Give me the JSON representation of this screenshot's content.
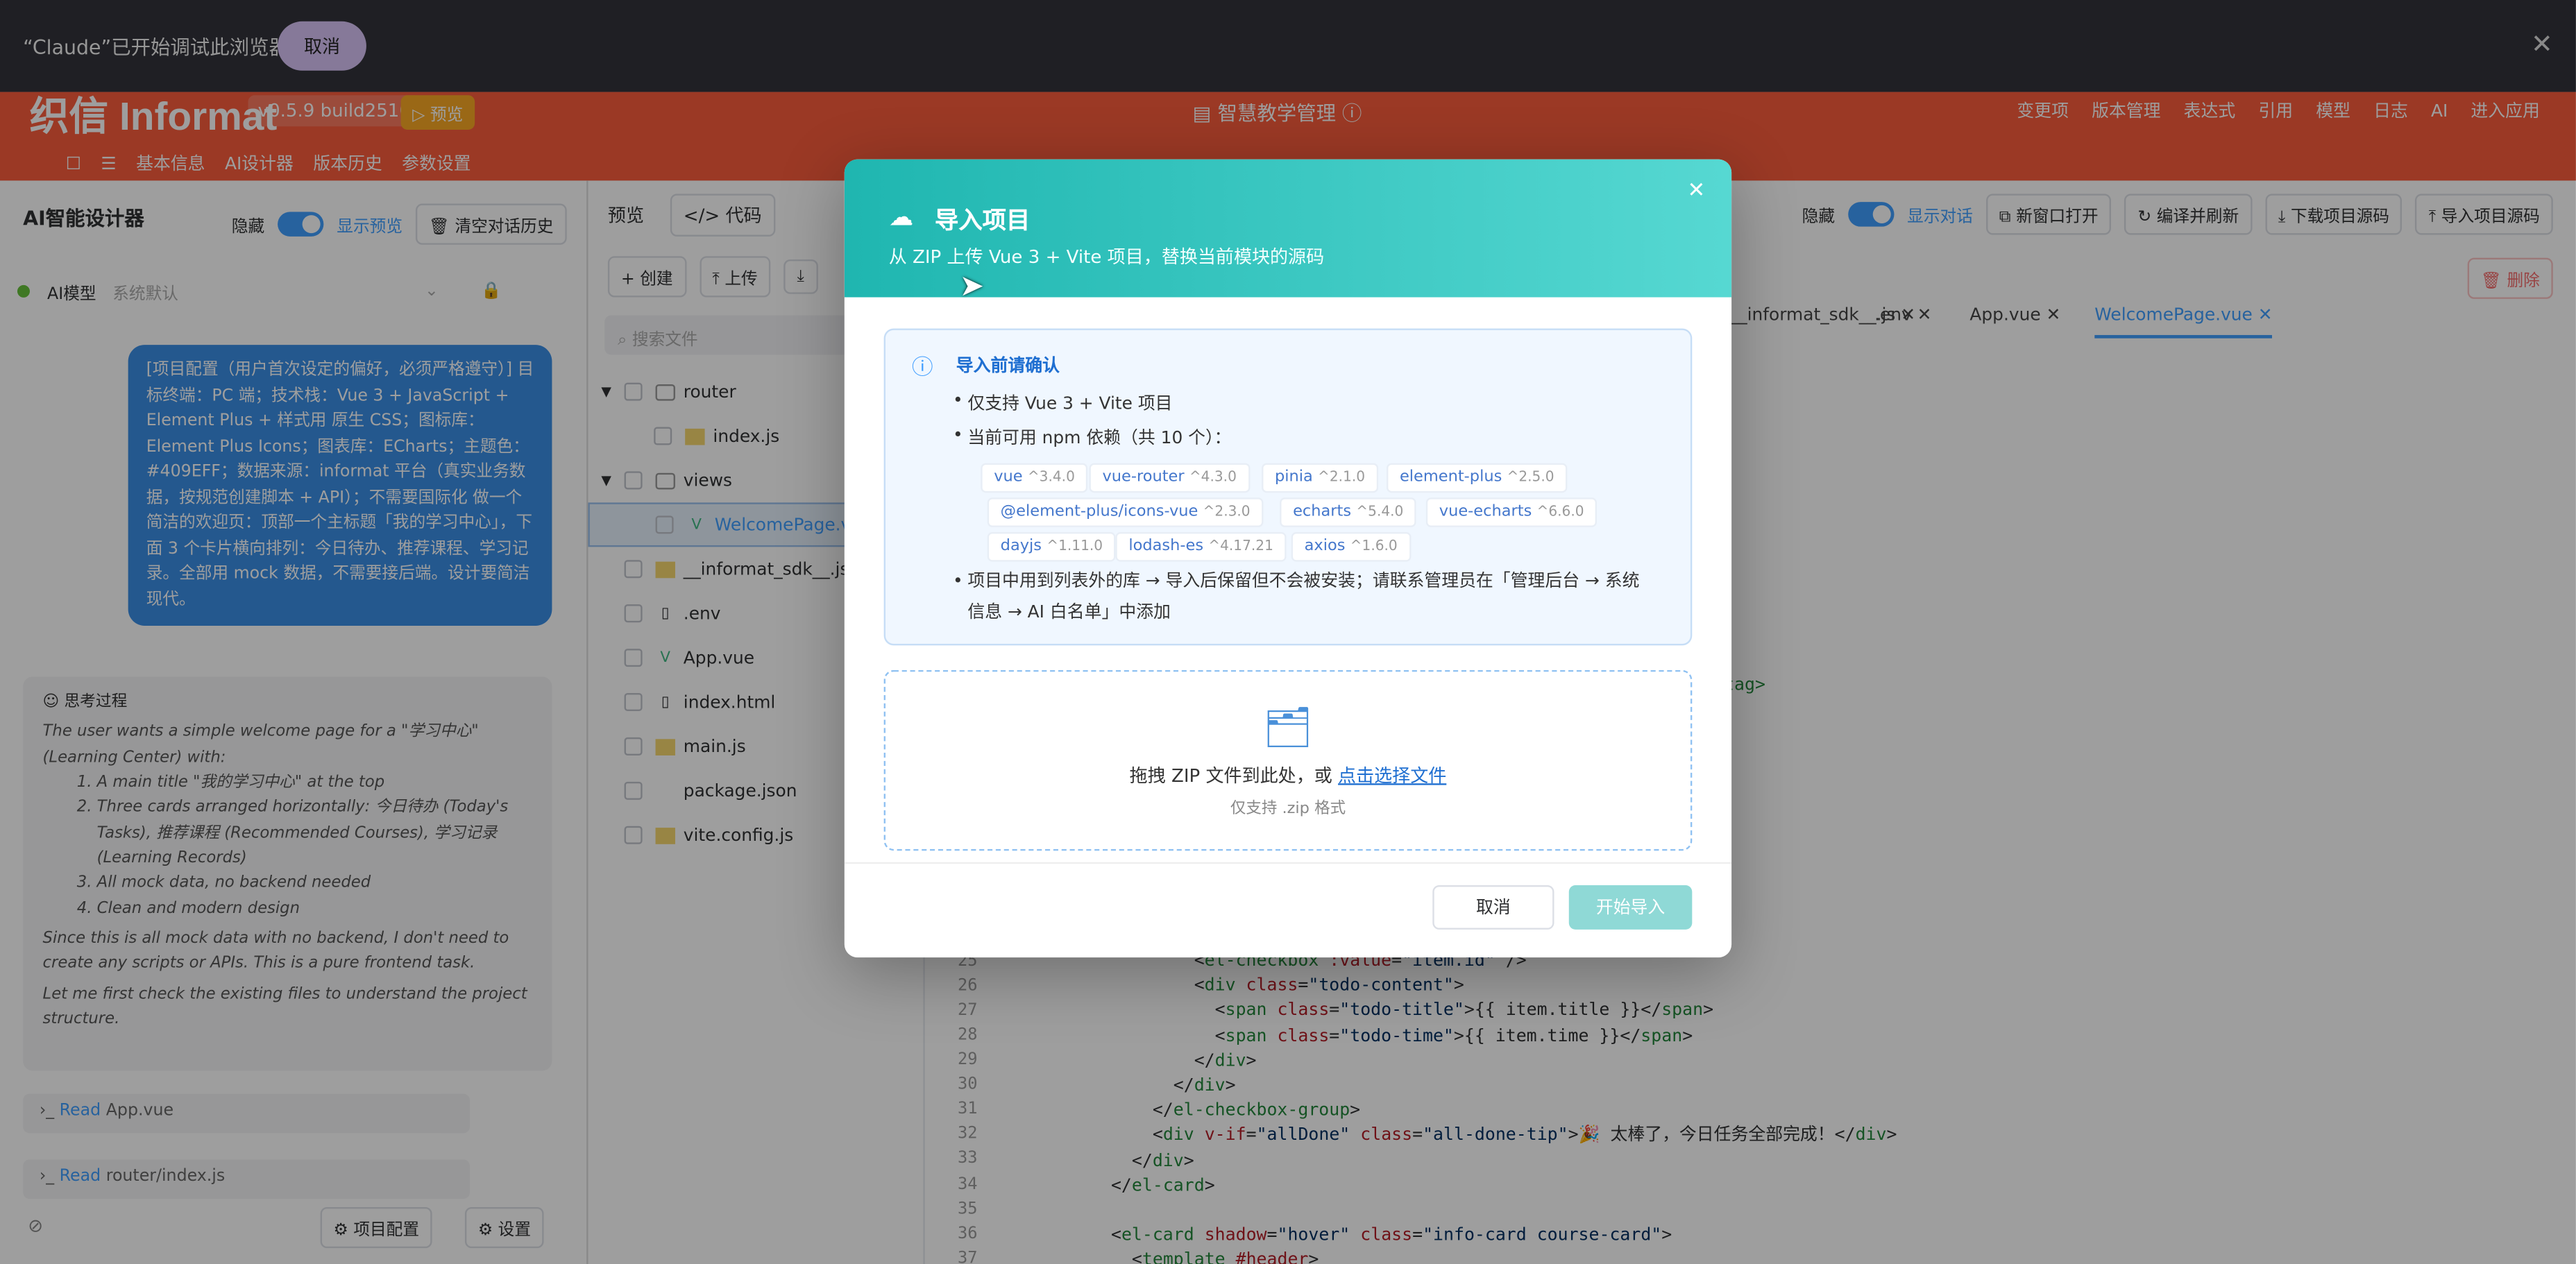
{
  "banner": {
    "text": "“Claude”已开始调试此浏览器",
    "cancel": "取消",
    "close": "✕"
  },
  "header": {
    "logo": "织信 Informat",
    "version": "v0.5.9 build2510",
    "preview_badge": "▷ 预览",
    "title": "智慧教学管理",
    "menu": [
      "变更项",
      "版本管理",
      "表达式",
      "引用",
      "模型",
      "日志",
      "AI",
      "进入应用"
    ],
    "tabs": [
      "基本信息",
      "AI设计器",
      "版本历史",
      "参数设置"
    ]
  },
  "left": {
    "title": "AI智能设计器",
    "hide": "隐藏",
    "show_preview": "显示预览",
    "clear": "清空对话历史",
    "model_label": "AI模型",
    "model_value": "系统默认",
    "user_msg": "[项目配置（用户首次设定的偏好，必须严格遵守）] 目标终端：PC 端；技术栈：Vue 3 + JavaScript + Element Plus + 样式用 原生 CSS；图标库：Element Plus Icons；图表库：ECharts；主题色：#409EFF；数据来源：informat 平台（真实业务数据，按规范创建脚本 + API）；不需要国际化 做一个简洁的欢迎页：顶部一个主标题「我的学习中心」，下面 3 个卡片横向排列：今日待办、推荐课程、学习记录。全部用 mock 数据，不需要接后端。设计要简洁现代。",
    "think_title": "思考过程",
    "think_intro": "The user wants a simple welcome page for a \"学习中心\" (Learning Center) with:",
    "think_items": [
      "A main title \"我的学习中心\" at the top",
      "Three cards arranged horizontally: 今日待办 (Today's Tasks), 推荐课程 (Recommended Courses), 学习记录 (Learning Records)",
      "All mock data, no backend needed",
      "Clean and modern design"
    ],
    "think_p1": "Since this is all mock data with no backend, I don't need to create any scripts or APIs. This is a pure frontend task.",
    "think_p2": "Let me first check the existing files to understand the project structure.",
    "tool1_verb": "Read",
    "tool1_file": "App.vue",
    "tool2_verb": "Read",
    "tool2_file": "router/index.js",
    "project_cfg": "项目配置",
    "settings": "设置"
  },
  "files": {
    "tab_preview": "预览",
    "tab_code": "代码",
    "create": "+ 创建",
    "upload": "上传",
    "search_placeholder": "搜索文件",
    "tree": [
      "router",
      "index.js",
      "views",
      "WelcomePage.vue",
      "__informat_sdk__.js",
      ".env",
      "App.vue",
      "index.html",
      "main.js",
      "package.json",
      "vite.config.js"
    ]
  },
  "editor": {
    "hide": "隐藏",
    "show_chat": "显示对话",
    "new_window": "新窗口打开",
    "compile": "编译并刷新",
    "download": "下载项目源码",
    "import": "导入项目源码",
    "delete": "删除",
    "tabs": [
      "__informat_sdk__.js",
      ".env",
      "App.vue",
      "WelcomePage.vue"
    ],
    "line_numbers": [
      "25",
      "26",
      "27",
      "28",
      "29",
      "30",
      "31",
      "32",
      "33",
      "34",
      "35",
      "36",
      "37"
    ],
    "fragment": "-tag>"
  },
  "modal": {
    "title": "导入项目",
    "subtitle": "从 ZIP 上传 Vue 3 + Vite 项目，替换当前模块的源码",
    "info_title": "导入前请确认",
    "bullet1": "仅支持 Vue 3 + Vite 项目",
    "bullet2": "当前可用 npm 依赖（共 10 个）：",
    "deps": [
      {
        "name": "vue",
        "ver": "^3.4.0"
      },
      {
        "name": "vue-router",
        "ver": "^4.3.0"
      },
      {
        "name": "pinia",
        "ver": "^2.1.0"
      },
      {
        "name": "element-plus",
        "ver": "^2.5.0"
      },
      {
        "name": "@element-plus/icons-vue",
        "ver": "^2.3.0"
      },
      {
        "name": "echarts",
        "ver": "^5.4.0"
      },
      {
        "name": "vue-echarts",
        "ver": "^6.6.0"
      },
      {
        "name": "dayjs",
        "ver": "^1.11.0"
      },
      {
        "name": "lodash-es",
        "ver": "^4.17.21"
      },
      {
        "name": "axios",
        "ver": "^1.6.0"
      }
    ],
    "bullet3a": "项目中用到列表外的库 → 导入后保留但不会被安装；请联系管理员在「管理后台 → 系统",
    "bullet3b": "信息 → AI 白名单」中添加",
    "drop_text": "拖拽 ZIP 文件到此处，或 ",
    "drop_link": "点击选择文件",
    "drop_hint": "仅支持 .zip 格式",
    "cancel": "取消",
    "start": "开始导入"
  },
  "colors": {
    "accent": "#409eff",
    "header": "#fb5c3c",
    "modal_header": "#1fb6b0"
  }
}
